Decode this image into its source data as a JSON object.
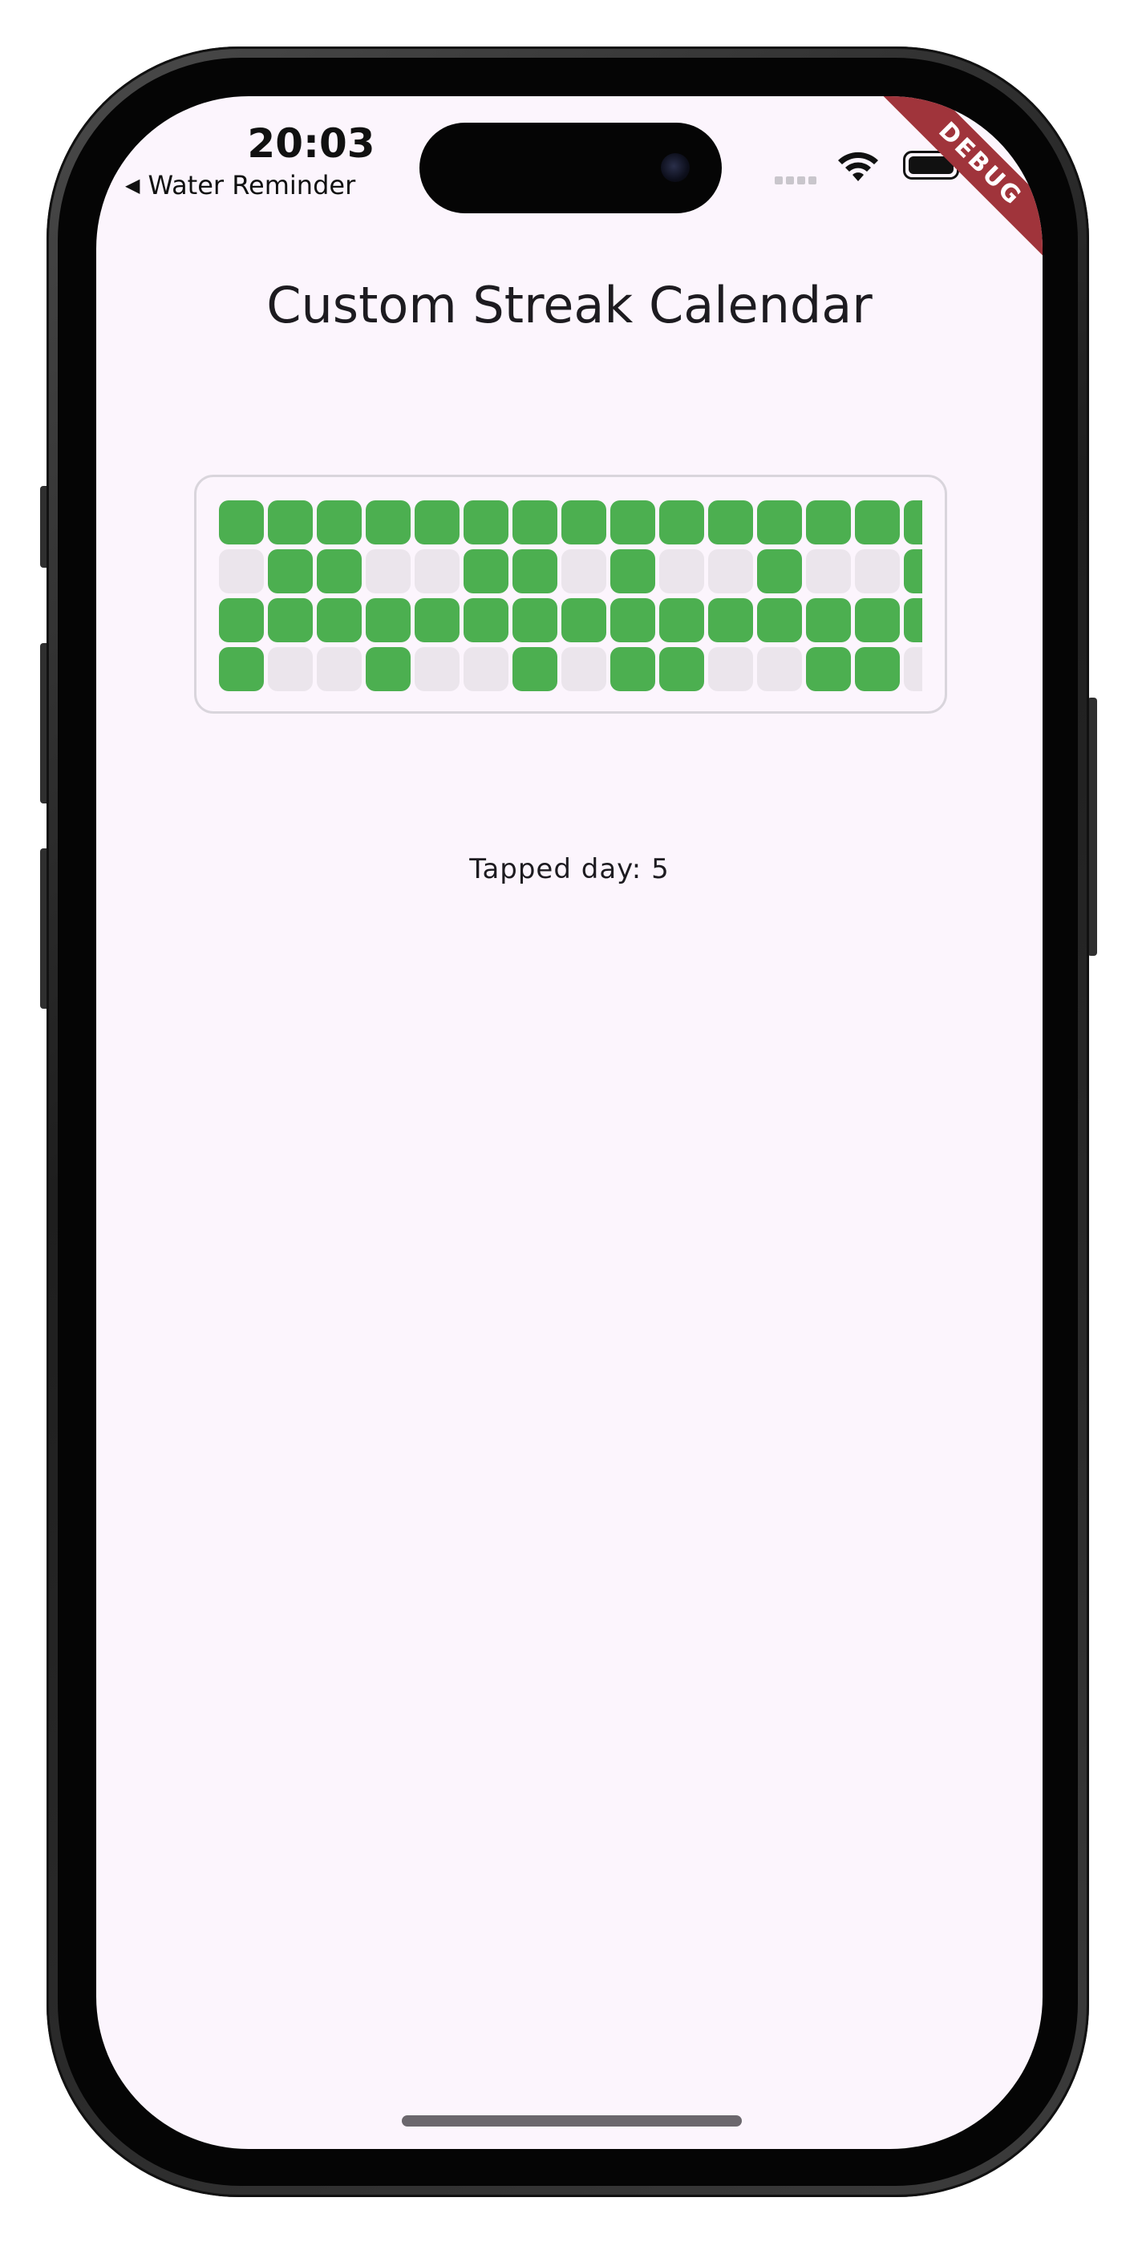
{
  "status_bar": {
    "time": "20:03",
    "back_label": "Water Reminder"
  },
  "debug_banner": "DEBUG",
  "title": "Custom Streak Calendar",
  "calendar": {
    "filled_color": "#4caf50",
    "empty_color": "#ebe5ec",
    "rows": [
      [
        1,
        1,
        1,
        1,
        1,
        1,
        1,
        1,
        1,
        1,
        1,
        1,
        1,
        1,
        1
      ],
      [
        0,
        1,
        1,
        0,
        0,
        1,
        1,
        0,
        1,
        0,
        0,
        1,
        0,
        0,
        1
      ],
      [
        1,
        1,
        1,
        1,
        1,
        1,
        1,
        1,
        1,
        1,
        1,
        1,
        1,
        1,
        1
      ],
      [
        1,
        0,
        0,
        1,
        0,
        0,
        1,
        0,
        1,
        1,
        0,
        0,
        1,
        1,
        0
      ]
    ]
  },
  "tapped_day_label": "Tapped day: 5"
}
